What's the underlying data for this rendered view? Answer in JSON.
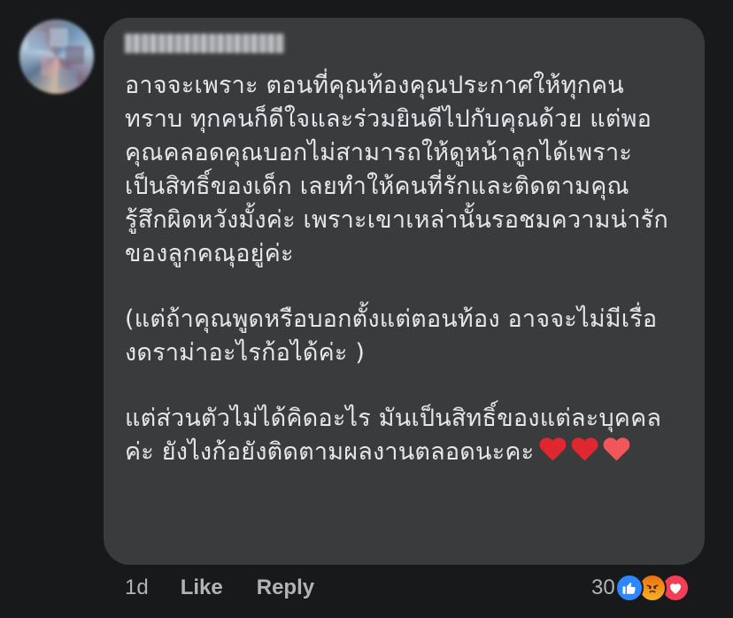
{
  "comment": {
    "author_name": "",
    "lines": [
      "อาจจะเพราะ ตอนที่คุณท้องคุณประกาศให้ทุกคน",
      "ทราบ ทุกคนก็ดีใจและร่วมยินดีไปกับคุณด้วย  แต่พอ",
      "คุณคลอดคุณบอกไม่สามารถให้ดูหน้าลูกได้เพราะ",
      "เป็นสิทธิ์ของเด็ก  เลยทำให้คนที่รักและติดตามคุณ",
      "รู้สึกผิดหวังมั้งค่ะ เพราะเขาเหล่านั้นรอชมความน่ารัก",
      "ของลูกคณุอยู่ค่ะ",
      "(แต่ถ้าคุณพูดหรือบอกตั้งแต่ตอนท้อง อาจจะไม่มีเรื่อ",
      "งดราม่าอะไรก้อได้ค่ะ )",
      "แต่ส่วนตัวไม่ได้คิดอะไร มันเป็นสิทธิ์ของแต่ละบุคคล",
      "ค่ะ ยังไงก้อยังติดตามผลงานตลอดนะคะ"
    ],
    "trailing_icons": [
      "heart-icon",
      "heart-icon",
      "heart-icon"
    ]
  },
  "actions": {
    "timestamp": "1d",
    "like_label": "Like",
    "reply_label": "Reply"
  },
  "reactions": {
    "count": "30",
    "icons": [
      "like-icon",
      "angry-icon",
      "love-icon"
    ],
    "colors": {
      "like": "#2d88ff",
      "angry": "#f0901a",
      "love": "#f33e58"
    }
  },
  "theme": {
    "background": "#18191a",
    "bubble": "#3a3b3c",
    "text": "#e4e6eb",
    "secondary_text": "#b0b3b8"
  }
}
